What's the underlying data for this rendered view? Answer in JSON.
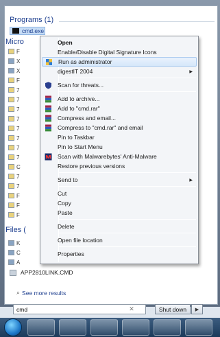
{
  "groups": {
    "programs": "Programs (1)",
    "microsoft": "Micro",
    "files": "Files ("
  },
  "program_result": "cmd.exe",
  "stub_rows": [
    "F",
    "X",
    "X",
    "F",
    "7",
    "7",
    "7",
    "7",
    "7",
    "7",
    "7",
    "7",
    "C",
    "7",
    "7",
    "F",
    "F",
    "F"
  ],
  "file_stub_rows": [
    "K",
    "C",
    "A"
  ],
  "file_result": "APP2810LINK.CMD",
  "see_more": "See more results",
  "search": {
    "value": "cmd"
  },
  "shutdown": {
    "label": "Shut down"
  },
  "context_menu": [
    {
      "label": "Open",
      "bold": true
    },
    {
      "label": "Enable/Disable Digital Signature Icons"
    },
    {
      "label": "Run as administrator",
      "icon": "shield-icon",
      "highlight": true
    },
    {
      "label": "digestIT 2004",
      "submenu": true
    },
    {
      "separator": true
    },
    {
      "label": "Scan for threats...",
      "icon": "antivirus-icon"
    },
    {
      "separator": true
    },
    {
      "label": "Add to archive...",
      "icon": "winrar-icon"
    },
    {
      "label": "Add to \"cmd.rar\"",
      "icon": "winrar-icon"
    },
    {
      "label": "Compress and email...",
      "icon": "winrar-icon"
    },
    {
      "label": "Compress to \"cmd.rar\" and email",
      "icon": "winrar-icon"
    },
    {
      "label": "Pin to Taskbar"
    },
    {
      "label": "Pin to Start Menu"
    },
    {
      "label": "Scan with Malwarebytes' Anti-Malware",
      "icon": "malwarebytes-icon"
    },
    {
      "label": "Restore previous versions"
    },
    {
      "separator": true
    },
    {
      "label": "Send to",
      "submenu": true
    },
    {
      "separator": true
    },
    {
      "label": "Cut"
    },
    {
      "label": "Copy"
    },
    {
      "label": "Paste"
    },
    {
      "separator": true
    },
    {
      "label": "Delete"
    },
    {
      "separator": true
    },
    {
      "label": "Open file location"
    },
    {
      "separator": true
    },
    {
      "label": "Properties"
    }
  ],
  "taskbar": [
    "start-orb",
    "explorer-icon",
    "outlook-icon",
    "ie-icon",
    "messenger-icon",
    "app-icon"
  ]
}
